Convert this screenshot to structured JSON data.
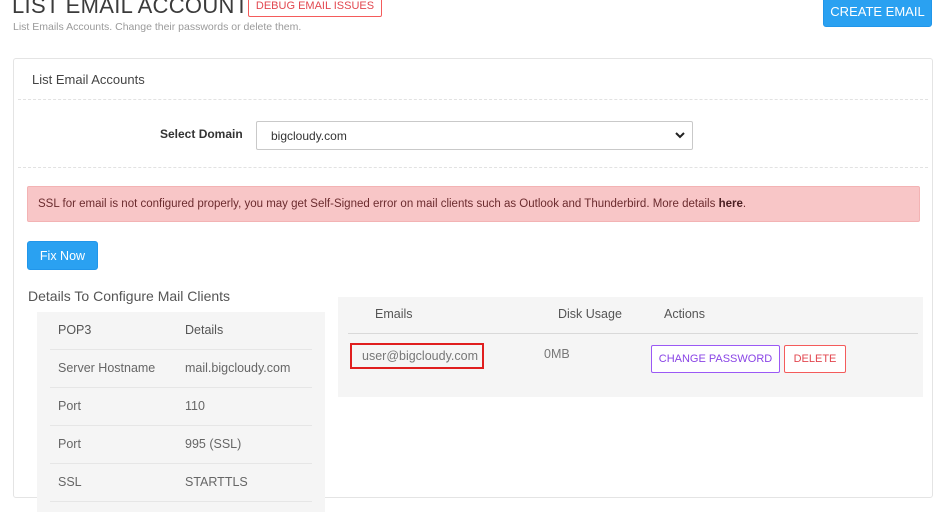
{
  "header": {
    "title": "LIST EMAIL ACCOUNTS -",
    "debug_button": "DEBUG EMAIL ISSUES",
    "subtitle": "List Emails Accounts. Change their passwords or delete them.",
    "create_button": "CREATE EMAIL"
  },
  "panel": {
    "title": "List Email Accounts",
    "select_label": "Select Domain",
    "select_value": "bigcloudy.com",
    "alert_text": "SSL for email is not configured properly, you may get Self-Signed error on mail clients such as Outlook and Thunderbird. More details",
    "alert_link": "here",
    "alert_end": ".",
    "fix_button": "Fix Now"
  },
  "mail_config": {
    "title": "Details To Configure Mail Clients",
    "header": [
      "POP3",
      "Details"
    ],
    "rows": [
      [
        "Server Hostname",
        "mail.bigcloudy.com"
      ],
      [
        "Port",
        "110"
      ],
      [
        "Port",
        "995 (SSL)"
      ],
      [
        "SSL",
        "STARTTLS"
      ]
    ]
  },
  "emails_table": {
    "headers": [
      "Emails",
      "Disk Usage",
      "Actions"
    ],
    "rows": [
      {
        "email": "user@bigcloudy.com",
        "disk": "0MB",
        "change_label": "CHANGE PASSWORD",
        "delete_label": "DELETE"
      }
    ]
  },
  "icons": {
    "select_chevron": "chevron-down-icon"
  },
  "colors": {
    "primary": "#2aa1f1",
    "danger": "#f45b5b",
    "purple": "#9b59f5",
    "alert_bg": "#f8c6c7",
    "highlight": "#e01e1e"
  }
}
